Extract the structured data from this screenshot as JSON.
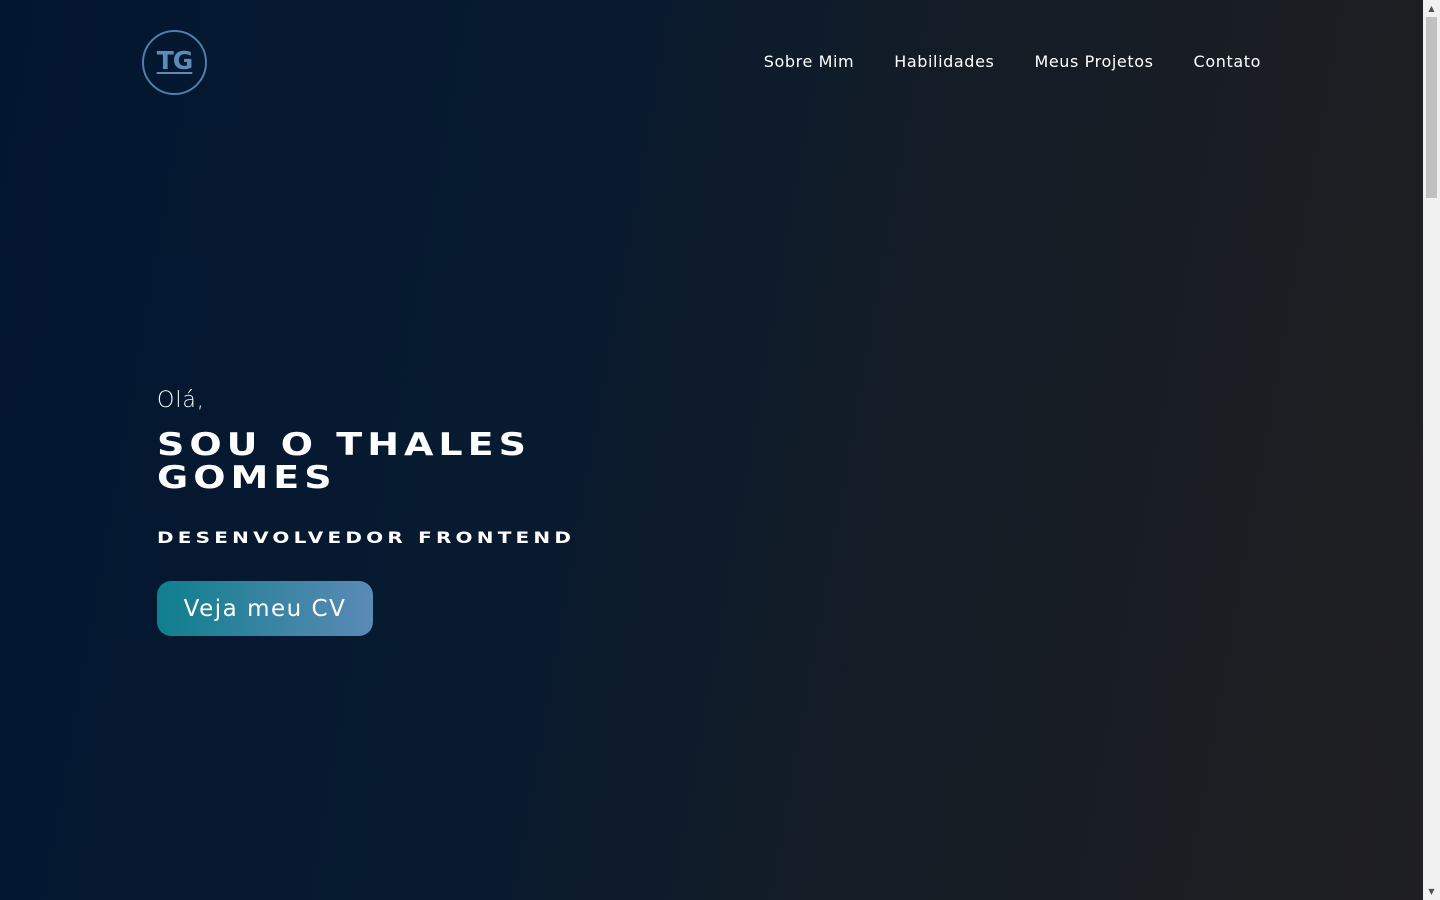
{
  "header": {
    "logo_text": "TG",
    "nav": [
      {
        "label": "Sobre Mim"
      },
      {
        "label": "Habilidades"
      },
      {
        "label": "Meus Projetos"
      },
      {
        "label": "Contato"
      }
    ]
  },
  "hero": {
    "greeting": "Olá,",
    "name": "Sou o Thales Gomes",
    "role": "Desenvolvedor Frontend",
    "cta_label": "Veja meu CV"
  },
  "colors": {
    "background_start": "#031631",
    "background_end": "#1f1f21",
    "logo_accent": "#4f7fa8",
    "button_gradient_start": "#0e7f8e",
    "button_gradient_end": "#5b8ab7",
    "text": "#ffffff"
  },
  "scrollbar": {
    "up_icon": "scroll-up-arrow-icon",
    "down_icon": "scroll-down-arrow-icon",
    "up_glyph": "▲",
    "down_glyph": "▼"
  }
}
